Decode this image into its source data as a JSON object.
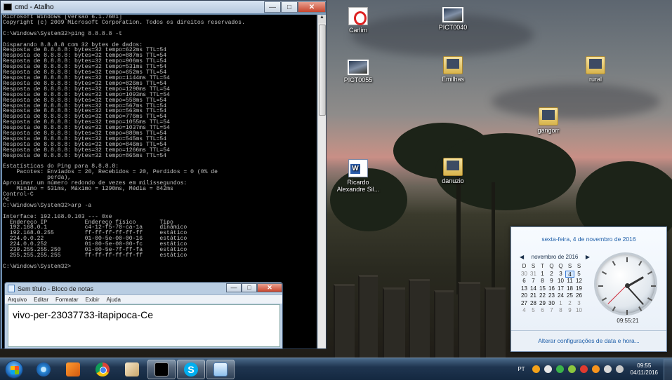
{
  "cmd_window": {
    "title": "cmd - Atalho",
    "console_lines": [
      "Microsoft Windows [versão 6.1.7601]",
      "Copyright (c) 2009 Microsoft Corporation. Todos os direitos reservados.",
      "",
      "C:\\Windows\\System32>ping 8.8.8.8 -t",
      "",
      "Disparando 8.8.8.8 com 32 bytes de dados:",
      "Resposta de 8.8.8.8: bytes=32 tempo=622ms TTL=54",
      "Resposta de 8.8.8.8: bytes=32 tempo=887ms TTL=54",
      "Resposta de 8.8.8.8: bytes=32 tempo=906ms TTL=54",
      "Resposta de 8.8.8.8: bytes=32 tempo=531ms TTL=54",
      "Resposta de 8.8.8.8: bytes=32 tempo=652ms TTL=54",
      "Resposta de 8.8.8.8: bytes=32 tempo=1144ms TTL=54",
      "Resposta de 8.8.8.8: bytes=32 tempo=826ms TTL=54",
      "Resposta de 8.8.8.8: bytes=32 tempo=1290ms TTL=54",
      "Resposta de 8.8.8.8: bytes=32 tempo=1093ms TTL=54",
      "Resposta de 8.8.8.8: bytes=32 tempo=558ms TTL=54",
      "Resposta de 8.8.8.8: bytes=32 tempo=567ms TTL=54",
      "Resposta de 8.8.8.8: bytes=32 tempo=563ms TTL=54",
      "Resposta de 8.8.8.8: bytes=32 tempo=776ms TTL=54",
      "Resposta de 8.8.8.8: bytes=32 tempo=1055ms TTL=54",
      "Resposta de 8.8.8.8: bytes=32 tempo=1037ms TTL=54",
      "Resposta de 8.8.8.8: bytes=32 tempo=880ms TTL=54",
      "Resposta de 8.8.8.8: bytes=32 tempo=545ms TTL=54",
      "Resposta de 8.8.8.8: bytes=32 tempo=846ms TTL=54",
      "Resposta de 8.8.8.8: bytes=32 tempo=1266ms TTL=54",
      "Resposta de 8.8.8.8: bytes=32 tempo=865ms TTL=54",
      "",
      "Estatísticas do Ping para 8.8.8.8:",
      "    Pacotes: Enviados = 20, Recebidos = 20, Perdidos = 0 (0% de",
      "             perda),",
      "Aproximar um número redondo de vezes em milissegundos:",
      "    Mínimo = 531ms, Máximo = 1290ms, Média = 842ms",
      "Control-C",
      "^C",
      "C:\\Windows\\System32>arp -a",
      "",
      "Interface: 192.168.0.103 --- 0xe",
      "  Endereço IP           Endereço físico       Tipo",
      "  192.168.0.1           c4-12-f5-70-ca-1a     dinâmico",
      "  192.168.0.255         ff-ff-ff-ff-ff-ff     estático",
      "  224.0.0.22            01-00-5e-00-00-16     estático",
      "  224.0.0.252           01-00-5e-00-00-fc     estático",
      "  239.255.255.250       01-00-5e-7f-ff-fa     estático",
      "  255.255.255.255       ff-ff-ff-ff-ff-ff     estático",
      "",
      "C:\\Windows\\System32>"
    ]
  },
  "notepad": {
    "title": "Sem título - Bloco de notas",
    "menu": [
      "Arquivo",
      "Editar",
      "Formatar",
      "Exibir",
      "Ajuda"
    ],
    "content": "vivo-per-23037733-itapipoca-Ce"
  },
  "desktop_icons": [
    {
      "label": "Carlim",
      "icon": "pdf-icon"
    },
    {
      "label": "PICT0040",
      "icon": "photo-icon"
    },
    {
      "label": "PICT0055",
      "icon": "photo-icon"
    },
    {
      "label": "Emilhas",
      "icon": "folder-icon"
    },
    {
      "label": "rural",
      "icon": "folder-icon"
    },
    {
      "label": "gangorr",
      "icon": "folder-icon"
    },
    {
      "label": "Ricardo Alexandre Sil...",
      "icon": "word-doc-icon"
    },
    {
      "label": "danuzio",
      "icon": "folder-icon"
    }
  ],
  "calendar_flyout": {
    "date_text": "sexta-feira, 4 de novembro de 2016",
    "month_label": "novembro de 2016",
    "weekdays": [
      "D",
      "S",
      "T",
      "Q",
      "Q",
      "S",
      "S"
    ],
    "weeks": [
      [
        "30",
        "31",
        "1",
        "2",
        "3",
        "4",
        "5"
      ],
      [
        "6",
        "7",
        "8",
        "9",
        "10",
        "11",
        "12"
      ],
      [
        "13",
        "14",
        "15",
        "16",
        "17",
        "18",
        "19"
      ],
      [
        "20",
        "21",
        "22",
        "23",
        "24",
        "25",
        "26"
      ],
      [
        "27",
        "28",
        "29",
        "30",
        "1",
        "2",
        "3"
      ],
      [
        "4",
        "5",
        "6",
        "7",
        "8",
        "9",
        "10"
      ]
    ],
    "selected_day": "4",
    "digital_time": "09:55:21",
    "settings_link": "Alterar configurações de data e hora..."
  },
  "taskbar": {
    "apps": [
      {
        "name": "internet-explorer",
        "active": false
      },
      {
        "name": "media-player",
        "active": false
      },
      {
        "name": "chrome",
        "active": false
      },
      {
        "name": "paint",
        "active": false
      },
      {
        "name": "cmd",
        "active": true
      },
      {
        "name": "skype",
        "active": true
      },
      {
        "name": "notepad",
        "active": true
      }
    ],
    "tray": {
      "language": "PT",
      "time": "09:55",
      "date": "04/11/2016"
    }
  },
  "colors": {
    "console_bg": "#000000",
    "console_fg": "#c0c0c0",
    "link": "#1e5ea8"
  }
}
